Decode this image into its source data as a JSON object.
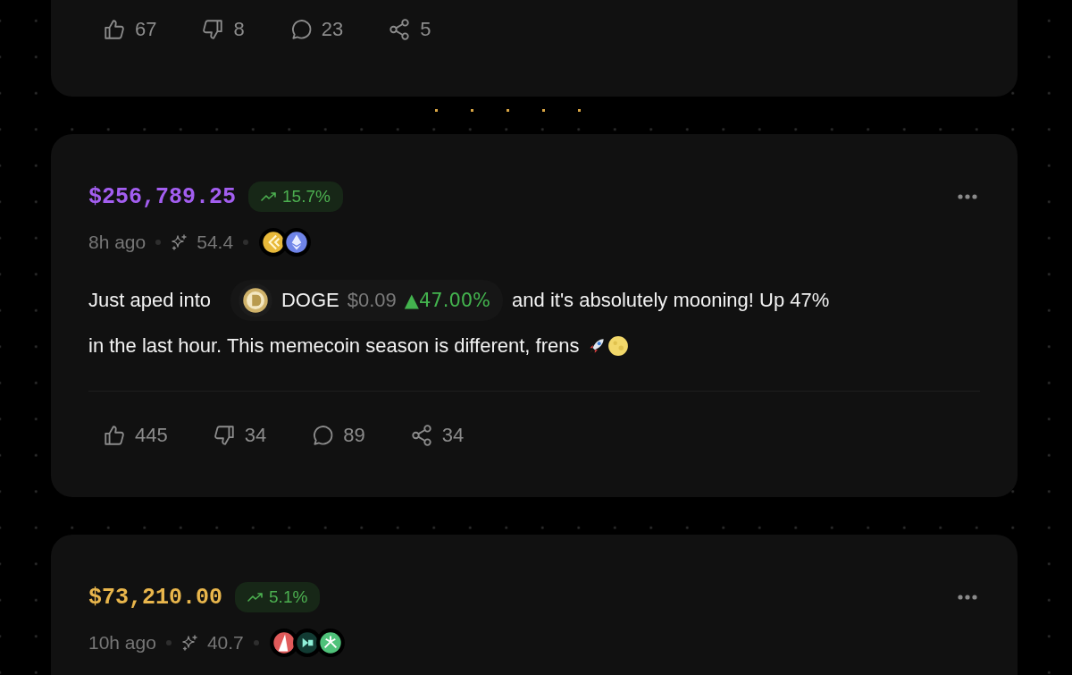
{
  "posts": [
    {
      "actions": [
        {
          "kind": "like",
          "count": "67"
        },
        {
          "kind": "dislike",
          "count": "8"
        },
        {
          "kind": "comment",
          "count": "23"
        },
        {
          "kind": "share",
          "count": "5"
        }
      ]
    },
    {
      "price": "$256,789.25",
      "color": "#a35ef0",
      "change": "15.7%",
      "time": "8h ago",
      "score": "54.4",
      "coins": [
        {
          "kind": "gold"
        },
        {
          "kind": "eth"
        }
      ],
      "body": [
        {
          "kind": "text",
          "text": "Just aped into"
        },
        {
          "kind": "token",
          "symbol": "DOGE",
          "price": "$0.09",
          "change": "▲47.00%"
        },
        {
          "kind": "text",
          "text": "and it's absolutely mooning! Up 47%"
        },
        {
          "kind": "text",
          "text": "in the last hour. This memecoin season is different, frens"
        },
        {
          "kind": "rocket"
        },
        {
          "kind": "moon"
        }
      ],
      "actions": [
        {
          "kind": "like",
          "count": "445"
        },
        {
          "kind": "dislike",
          "count": "34"
        },
        {
          "kind": "comment",
          "count": "89"
        },
        {
          "kind": "share",
          "count": "34"
        }
      ]
    },
    {
      "price": "$73,210.00",
      "color": "#e9b64c",
      "change": "5.1%",
      "time": "10h ago",
      "score": "40.7",
      "coins": [
        {
          "kind": "red"
        },
        {
          "kind": "teal"
        },
        {
          "kind": "green"
        }
      ]
    }
  ]
}
